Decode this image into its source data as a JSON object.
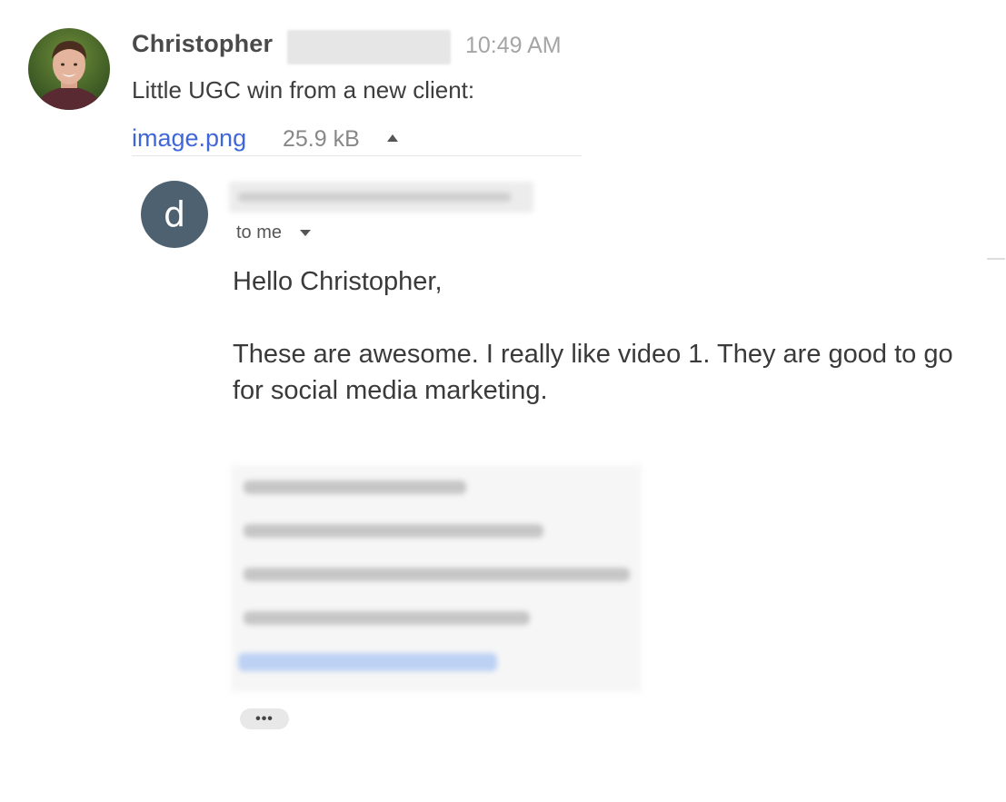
{
  "message": {
    "sender_name": "Christopher",
    "timestamp": "10:49 AM",
    "text": "Little UGC win from a new client:",
    "attachment": {
      "file_name": "image.png",
      "file_size": "25.9 kB"
    }
  },
  "email": {
    "avatar_letter": "d",
    "recipient_label": "to me",
    "greeting": "Hello Christopher,",
    "body": "These are awesome. I really like video 1. They are good to go for social media marketing.",
    "more_label": "•••"
  },
  "colors": {
    "link": "#3f67d9",
    "email_avatar_bg": "#4e6171",
    "timestamp": "#a5a5a5"
  }
}
